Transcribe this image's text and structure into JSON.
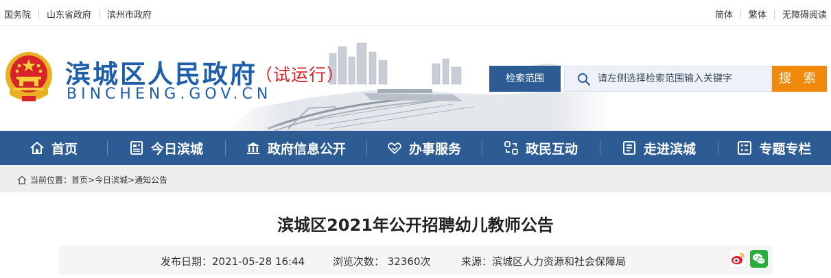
{
  "topbar": {
    "links": [
      "国务院",
      "山东省政府",
      "滨州市政府"
    ],
    "right_links": [
      "简体",
      "繁体",
      "无障碍阅读"
    ]
  },
  "header": {
    "title": "滨城区人民政府",
    "trial": "（试运行）",
    "domain": "BINCHENG.GOV.CN",
    "scope_button": "检索范围",
    "search_placeholder": "请左侧选择检索范围输入关键字",
    "search_button": "搜 索"
  },
  "nav": {
    "items": [
      {
        "label": "首页",
        "icon": "home-icon"
      },
      {
        "label": "今日滨城",
        "icon": "newspaper-icon"
      },
      {
        "label": "政府信息公开",
        "icon": "building-icon"
      },
      {
        "label": "办事服务",
        "icon": "handshake-icon"
      },
      {
        "label": "政民互动",
        "icon": "interaction-icon"
      },
      {
        "label": "走进滨城",
        "icon": "profile-card-icon"
      },
      {
        "label": "专题专栏",
        "icon": "list-icon"
      }
    ]
  },
  "breadcrumb": {
    "text": "当前位置：首页>今日滨城>通知公告"
  },
  "article": {
    "title": "滨城区2021年公开招聘幼儿教师公告",
    "date": "发布日期：2021-05-28 16:44",
    "views": "浏览次数： 32360次",
    "source": "来源：滨城区人力资源和社会保障局",
    "share_icons": [
      "weibo-icon",
      "wechat-icon"
    ]
  },
  "colors": {
    "primary": "#2d5b94",
    "title_blue": "#1f5ea8",
    "accent_orange": "#f08a0c",
    "trial_red": "#d8232a"
  }
}
